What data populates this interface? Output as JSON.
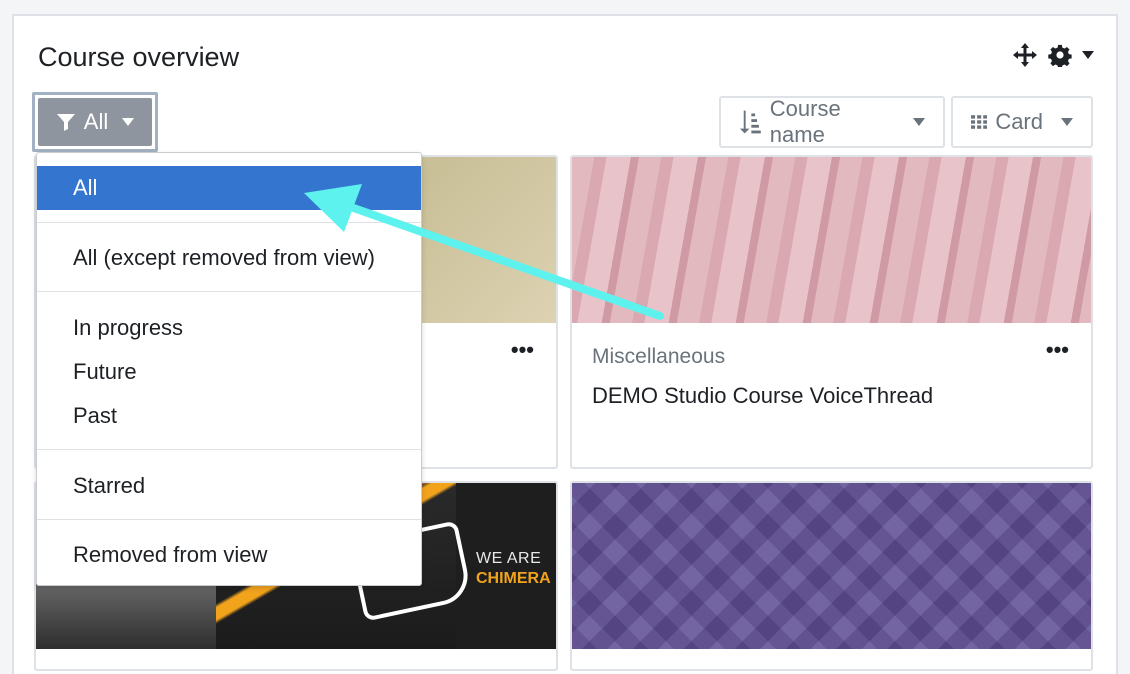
{
  "block": {
    "title": "Course overview",
    "move_icon": "move-icon",
    "settings_icon": "gear-icon"
  },
  "filter": {
    "label": "All",
    "icon": "filter-icon"
  },
  "sort": {
    "label": "Course name",
    "icon": "sort-icon"
  },
  "view": {
    "label": "Card",
    "icon": "grid-icon"
  },
  "dropdown": {
    "items": [
      {
        "label": "All",
        "active": true
      },
      {
        "label": "All (except removed from view)"
      },
      {
        "label": "In progress"
      },
      {
        "label": "Future"
      },
      {
        "label": "Past"
      },
      {
        "label": "Starred"
      },
      {
        "label": "Removed from view"
      }
    ]
  },
  "courses": [
    {
      "category": "",
      "name": ""
    },
    {
      "category": "Miscellaneous",
      "name": "DEMO Studio Course VoiceThread"
    },
    {
      "image_text_line1": "WE ARE",
      "image_text_line2": "CHIMERA"
    },
    {}
  ],
  "more_label": "•••",
  "colors": {
    "active": "#3476cf",
    "annotation_arrow": "#5ef2ee",
    "filter_button": "#8f959e"
  }
}
